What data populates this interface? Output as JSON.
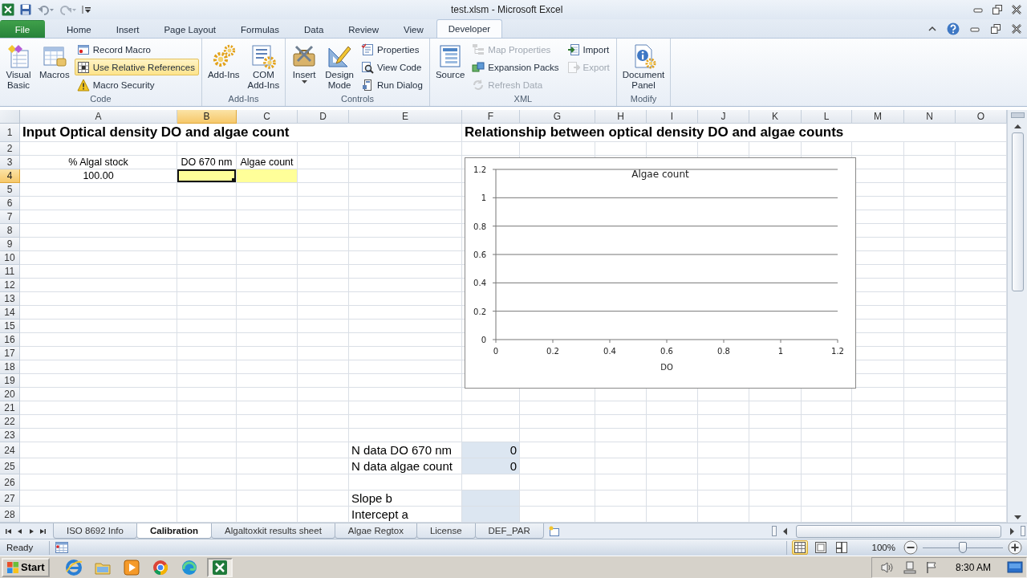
{
  "window": {
    "title": "test.xlsm - Microsoft Excel"
  },
  "ribbon": {
    "tabs": [
      {
        "label": "File",
        "kind": "file",
        "selected": false
      },
      {
        "label": "Home",
        "kind": "tab",
        "selected": false
      },
      {
        "label": "Insert",
        "kind": "tab",
        "selected": false
      },
      {
        "label": "Page Layout",
        "kind": "tab",
        "selected": false
      },
      {
        "label": "Formulas",
        "kind": "tab",
        "selected": false
      },
      {
        "label": "Data",
        "kind": "tab",
        "selected": false
      },
      {
        "label": "Review",
        "kind": "tab",
        "selected": false
      },
      {
        "label": "View",
        "kind": "tab",
        "selected": false
      },
      {
        "label": "Developer",
        "kind": "tab",
        "selected": true
      }
    ],
    "groups": [
      {
        "label": "Code",
        "items": [
          {
            "label": "Visual\nBasic",
            "kind": "large",
            "on": false,
            "disabled": false
          },
          {
            "label": "Macros",
            "kind": "large",
            "on": false,
            "disabled": false
          },
          {
            "label": "Record Macro",
            "kind": "small",
            "on": false,
            "disabled": false
          },
          {
            "label": "Use Relative References",
            "kind": "small",
            "on": true,
            "disabled": false
          },
          {
            "label": "Macro Security",
            "kind": "small",
            "on": false,
            "disabled": false
          }
        ]
      },
      {
        "label": "Add-Ins",
        "items": [
          {
            "label": "Add-Ins",
            "kind": "large",
            "on": false,
            "disabled": false
          },
          {
            "label": "COM\nAdd-Ins",
            "kind": "large",
            "on": false,
            "disabled": false
          }
        ]
      },
      {
        "label": "Controls",
        "items": [
          {
            "label": "Insert",
            "kind": "menu",
            "on": false,
            "disabled": false
          },
          {
            "label": "Design\nMode",
            "kind": "large",
            "on": false,
            "disabled": false
          },
          {
            "label": "Properties",
            "kind": "small",
            "on": false,
            "disabled": false
          },
          {
            "label": "View Code",
            "kind": "small",
            "on": false,
            "disabled": false
          },
          {
            "label": "Run Dialog",
            "kind": "small",
            "on": false,
            "disabled": false
          }
        ]
      },
      {
        "label": "XML",
        "items": [
          {
            "label": "Source",
            "kind": "large",
            "on": false,
            "disabled": false
          },
          {
            "label": "Map Properties",
            "kind": "small",
            "on": false,
            "disabled": true
          },
          {
            "label": "Expansion Packs",
            "kind": "small",
            "on": false,
            "disabled": false
          },
          {
            "label": "Refresh Data",
            "kind": "small",
            "on": false,
            "disabled": true
          },
          {
            "label": "Import",
            "kind": "small",
            "on": false,
            "disabled": false
          },
          {
            "label": "Export",
            "kind": "small",
            "on": false,
            "disabled": true
          }
        ]
      },
      {
        "label": "Modify",
        "items": [
          {
            "label": "Document\nPanel",
            "kind": "large",
            "on": false,
            "disabled": false
          }
        ]
      }
    ]
  },
  "sheet": {
    "columns": [
      {
        "label": "A",
        "selected": false
      },
      {
        "label": "B",
        "selected": true
      },
      {
        "label": "C",
        "selected": false
      },
      {
        "label": "D",
        "selected": false
      },
      {
        "label": "E",
        "selected": false
      },
      {
        "label": "F",
        "selected": false
      },
      {
        "label": "G",
        "selected": false
      },
      {
        "label": "H",
        "selected": false
      },
      {
        "label": "I",
        "selected": false
      },
      {
        "label": "J",
        "selected": false
      },
      {
        "label": "K",
        "selected": false
      },
      {
        "label": "L",
        "selected": false
      },
      {
        "label": "M",
        "selected": false
      },
      {
        "label": "N",
        "selected": false
      },
      {
        "label": "O",
        "selected": false
      }
    ],
    "rows": [
      {
        "label": "1",
        "selected": false,
        "cells": [
          {
            "kind": "heading",
            "text": "Input Optical density DO and algae count",
            "selected": false
          }
        ]
      },
      {
        "label": "2",
        "selected": false
      },
      {
        "label": "3",
        "selected": false,
        "cells": [
          {
            "kind": "caption",
            "text": "% Algal stock",
            "selected": false
          },
          {
            "kind": "caption",
            "text": "DO 670 nm",
            "selected": false
          },
          {
            "kind": "caption",
            "text": "Algae count",
            "selected": false
          }
        ]
      },
      {
        "label": "4",
        "selected": true,
        "cells": [
          {
            "kind": "caption",
            "text": "100.00",
            "selected": false
          },
          {
            "kind": "caption",
            "color": "#ffff99",
            "selected": true
          },
          {
            "kind": "caption",
            "color": "#ffff99",
            "selected": false
          }
        ]
      },
      {
        "label": "5",
        "selected": false
      },
      {
        "label": "6",
        "selected": false
      },
      {
        "label": "7",
        "selected": false
      },
      {
        "label": "8",
        "selected": false
      },
      {
        "label": "9",
        "selected": false
      },
      {
        "label": "10",
        "selected": false
      },
      {
        "label": "11",
        "selected": false
      },
      {
        "label": "12",
        "selected": false
      },
      {
        "label": "13",
        "selected": false
      },
      {
        "label": "14",
        "selected": false
      },
      {
        "label": "15",
        "selected": false
      },
      {
        "label": "16",
        "selected": false
      },
      {
        "label": "17",
        "selected": false
      },
      {
        "label": "18",
        "selected": false
      },
      {
        "label": "19",
        "selected": false
      },
      {
        "label": "20",
        "selected": false
      },
      {
        "label": "21",
        "selected": false
      },
      {
        "label": "22",
        "selected": false
      },
      {
        "label": "23",
        "selected": false
      },
      {
        "label": "24",
        "selected": false,
        "cells": [
          {
            "selected": false
          },
          {
            "selected": false
          },
          {
            "selected": false
          },
          {
            "selected": false
          },
          {
            "kind": "label",
            "text": "N data DO 670 nm",
            "selected": false
          },
          {
            "kind": "number",
            "text": "0",
            "color": "#dce6f1",
            "selected": false
          }
        ]
      },
      {
        "label": "25",
        "selected": false,
        "cells": [
          {
            "selected": false
          },
          {
            "selected": false
          },
          {
            "selected": false
          },
          {
            "selected": false
          },
          {
            "kind": "label",
            "text": "N data algae count",
            "selected": false
          },
          {
            "kind": "number",
            "text": "0",
            "color": "#dce6f1",
            "selected": false
          }
        ]
      },
      {
        "label": "26",
        "selected": false
      },
      {
        "label": "27",
        "selected": false,
        "cells": [
          {
            "selected": false
          },
          {
            "selected": false
          },
          {
            "selected": false
          },
          {
            "selected": false
          },
          {
            "kind": "label",
            "text": "Slope b",
            "selected": false
          },
          {
            "kind": "number",
            "color": "#dce6f1",
            "selected": false
          }
        ]
      },
      {
        "label": "28",
        "selected": false,
        "cells": [
          {
            "selected": false
          },
          {
            "selected": false
          },
          {
            "selected": false
          },
          {
            "selected": false
          },
          {
            "kind": "label",
            "text": "Intercept a",
            "selected": false
          },
          {
            "kind": "number",
            "color": "#dce6f1",
            "selected": false
          }
        ]
      }
    ],
    "chart": {
      "heading": "Relationship between optical density DO and algae counts",
      "chart_data": {
        "type": "scatter",
        "grid": true,
        "title": "Algae count",
        "xlabel": "DO",
        "xlim": [
          0,
          1.2
        ],
        "ylim": [
          0,
          1.2
        ],
        "xticks": [
          0,
          0.2,
          0.4,
          0.6,
          0.8,
          1,
          1.2
        ],
        "yticks": [
          0,
          0.2,
          0.4,
          0.6,
          0.8,
          1,
          1.2
        ]
      }
    }
  },
  "sheet_tabs": [
    {
      "label": "ISO 8692 Info",
      "selected": false
    },
    {
      "label": "Calibration",
      "selected": true
    },
    {
      "label": "Algaltoxkit results sheet",
      "selected": false
    },
    {
      "label": "Algae Regtox",
      "selected": false
    },
    {
      "label": "License",
      "selected": false
    },
    {
      "label": "DEF_PAR",
      "selected": false
    }
  ],
  "status_bar": {
    "text": "Ready",
    "views": [
      {
        "selected": true
      },
      {
        "selected": false
      },
      {
        "selected": false
      }
    ],
    "zoom": "100%",
    "zoom_slider": {
      "level": 0.5
    }
  },
  "taskbar": {
    "start": "Start",
    "apps": [
      {
        "selected": false
      },
      {
        "selected": false
      },
      {
        "selected": false
      },
      {
        "selected": false
      },
      {
        "selected": false
      },
      {
        "selected": true
      }
    ],
    "clock": "8:30 AM"
  }
}
